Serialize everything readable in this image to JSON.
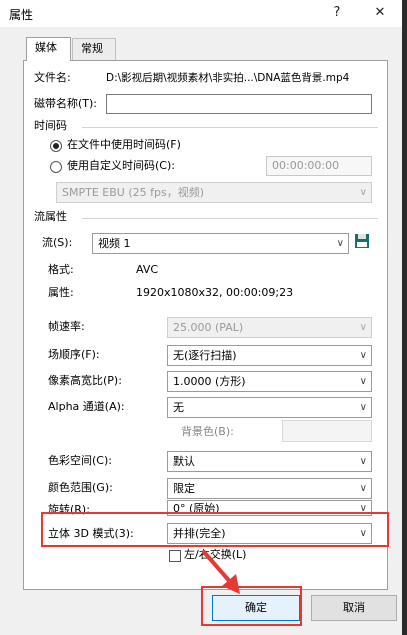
{
  "window": {
    "title": "属性",
    "help_label": "?",
    "close_label": "✕"
  },
  "tabs": [
    {
      "label": "媒体"
    },
    {
      "label": "常规"
    }
  ],
  "file": {
    "label": "文件名:",
    "value": "D:\\影视后期\\视频素材\\非实拍...\\DNA蓝色背景.mp4"
  },
  "tape": {
    "label": "磁带名称(T):",
    "value": ""
  },
  "timecode": {
    "section_label": "时间码",
    "use_file_label": "在文件中使用时间码(F)",
    "use_custom_label": "使用自定义时间码(C):",
    "custom_value": "00:00:00:00",
    "format_value": "SMPTE EBU (25 fps，视频)"
  },
  "stream": {
    "section_label": "流属性",
    "stream_label": "流(S):",
    "stream_value": "视频 1",
    "format_label": "格式:",
    "format_value": "AVC",
    "attr_label": "属性:",
    "attr_value": "1920x1080x32, 00:00:09;23"
  },
  "props": {
    "frame_rate_label": "帧速率:",
    "frame_rate_value": "25.000 (PAL)",
    "field_order_label": "场顺序(F):",
    "field_order_value": "无(逐行扫描)",
    "pixel_aspect_label": "像素高宽比(P):",
    "pixel_aspect_value": "1.0000 (方形)",
    "alpha_label": "Alpha 通道(A):",
    "alpha_value": "无",
    "bg_color_label": "背景色(B):",
    "color_space_label": "色彩空间(C):",
    "color_space_value": "默认",
    "color_range_label": "颜色范围(G):",
    "color_range_value": "限定",
    "rotate_label": "旋转(R):",
    "rotate_value": "0° (原始)",
    "stereo_label": "立体 3D 模式(3):",
    "stereo_value": "并排(完全)",
    "swap_label": "左/右交换(L)"
  },
  "buttons": {
    "ok_label": "确定",
    "cancel_label": "取消"
  },
  "colors": {
    "highlight": "#e53935"
  }
}
